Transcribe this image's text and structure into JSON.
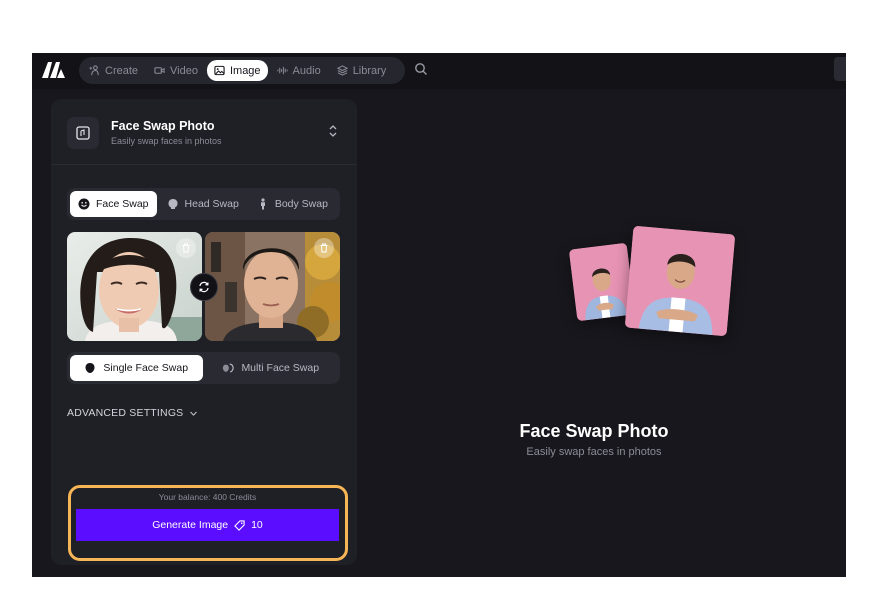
{
  "nav": {
    "items": [
      {
        "label": "Create",
        "icon": "sparkle-person-icon"
      },
      {
        "label": "Video",
        "icon": "video-icon"
      },
      {
        "label": "Image",
        "icon": "image-icon"
      },
      {
        "label": "Audio",
        "icon": "audio-wave-icon"
      },
      {
        "label": "Library",
        "icon": "layers-icon"
      }
    ],
    "active": "Image"
  },
  "tool": {
    "title": "Face Swap Photo",
    "subtitle": "Easily swap faces in photos"
  },
  "swap_tabs": [
    {
      "label": "Face Swap",
      "icon": "smile-icon"
    },
    {
      "label": "Head Swap",
      "icon": "head-icon"
    },
    {
      "label": "Body Swap",
      "icon": "body-icon"
    }
  ],
  "mode_tabs": [
    {
      "label": "Single Face Swap",
      "icon": "single-face-icon"
    },
    {
      "label": "Multi Face Swap",
      "icon": "multi-face-icon"
    }
  ],
  "advanced_label": "ADVANCED SETTINGS",
  "balance_text": "Your balance: 400 Credits",
  "generate": {
    "label": "Generate Image",
    "cost": "10"
  },
  "preview": {
    "title": "Face Swap Photo",
    "subtitle": "Easily swap faces in photos"
  },
  "colors": {
    "accent": "#5B0DFF",
    "highlight": "#F6B557",
    "background": "#17171D",
    "panel": "#1F1F26",
    "card_pink": "#E793B3"
  }
}
